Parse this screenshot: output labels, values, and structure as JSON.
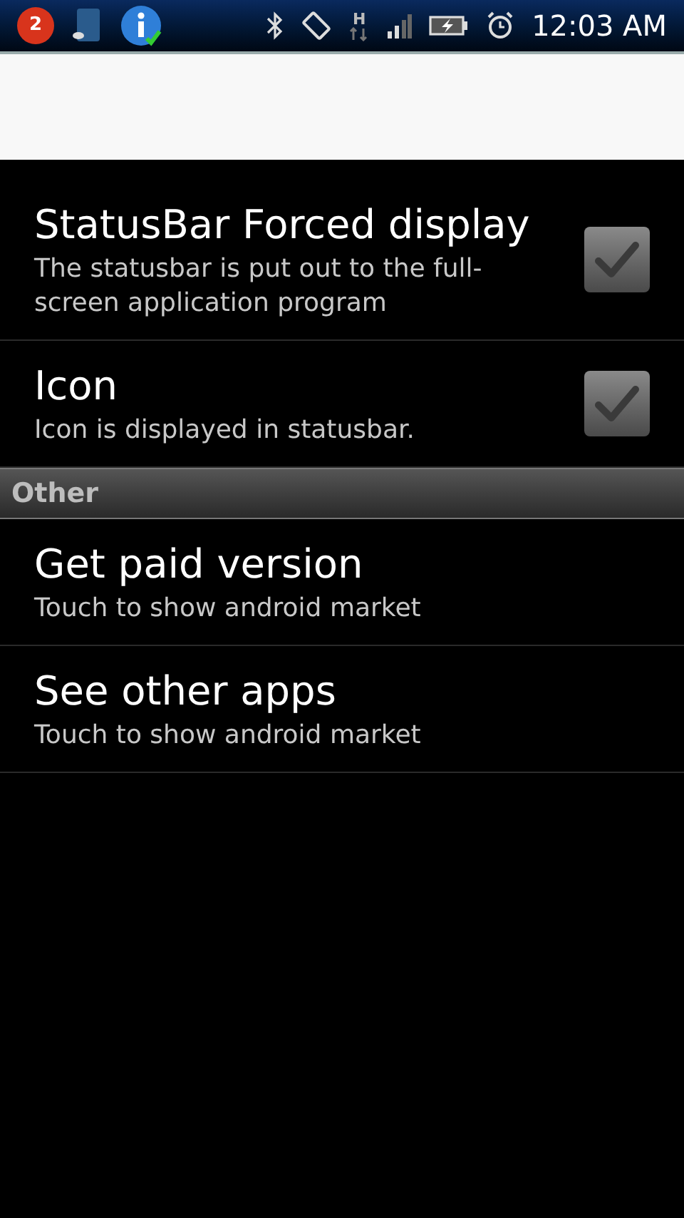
{
  "status_bar": {
    "notification_count": "2",
    "network_type": "H",
    "time": "12:03 AM"
  },
  "settings": [
    {
      "kind": "checkbox",
      "title": "StatusBar Forced display",
      "summary": "The statusbar is put out to the full-screen application program",
      "checked": false
    },
    {
      "kind": "checkbox",
      "title": "Icon",
      "summary": "Icon is displayed in statusbar.",
      "checked": false
    },
    {
      "kind": "header",
      "title": "Other"
    },
    {
      "kind": "link",
      "title": "Get paid version",
      "summary": "Touch to show android market"
    },
    {
      "kind": "link",
      "title": "See other apps",
      "summary": "Touch to show android market"
    }
  ]
}
